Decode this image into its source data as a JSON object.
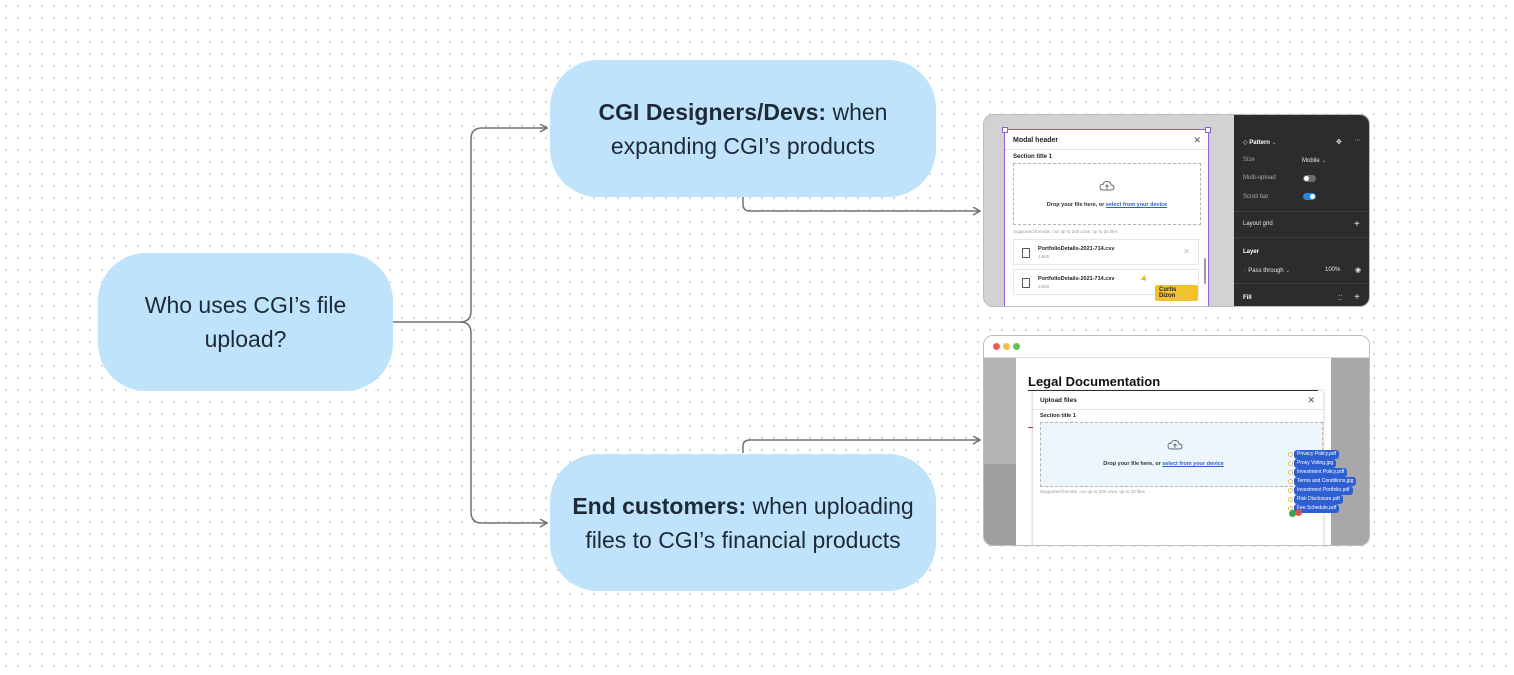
{
  "diagram": {
    "root": {
      "text": "Who uses CGI’s file upload?"
    },
    "branches": [
      {
        "bold": "CGI Designers/Devs:",
        "rest": " when expanding CGI’s products"
      },
      {
        "bold": "End customers:",
        "rest": " when uploading files to CGI’s financial products"
      }
    ],
    "colors": {
      "node_fill": "#bfe3fb",
      "connector": "#707070"
    }
  },
  "thumb1": {
    "modal_header": "Modal header",
    "section_title": "Section title 1",
    "drop_text": "Drop your file here, or ",
    "drop_link": "select from your device",
    "supported": "Supported formats .csv up to 200 rows, up to 25 files",
    "files": [
      {
        "name": "PortfolioDetails-2021-714.csv",
        "size": "24KB"
      },
      {
        "name": "PortfolioDetails-2021-714.csv",
        "size": "24KB"
      }
    ],
    "cursor_label": "Curtis Dizon",
    "panel": {
      "pattern": "Pattern",
      "size_label": "Size",
      "size_value": "Mobile",
      "multi_upload": "Multi-upload",
      "multi_upload_on": false,
      "scroll_bar": "Scroll bar",
      "scroll_bar_on": true,
      "layout_grid": "Layout grid",
      "layer": "Layer",
      "pass_through": "Pass through",
      "opacity": "100%",
      "fill": "Fill"
    }
  },
  "thumb2": {
    "page_title": "Legal Documentation",
    "modal_header": "Upload files",
    "section_title": "Section title 1",
    "drop_text": "Drop your file here, or ",
    "drop_link": "select from your device",
    "supported": "Supported formats .csv up to 200 rows, up to 25 files",
    "dragged_files": [
      "Privacy Policy.pdf",
      "Proxy Voting.jpg",
      "Investment Policy.pdf",
      "Terms and Conditions.jpg",
      "Investment Portfolio.pdf",
      "Risk Disclosure.pdf",
      "Fee Schedule.pdf"
    ]
  }
}
